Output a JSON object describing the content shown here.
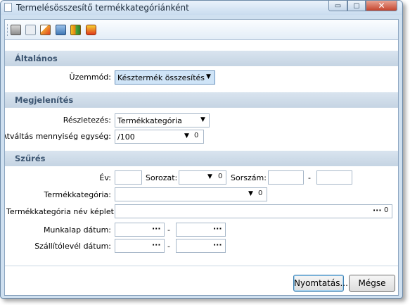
{
  "window": {
    "title": "Termelésösszesítő termékkategóriánként",
    "minimize_glyph": "▭",
    "maximize_glyph": "▢",
    "close_glyph": "✕"
  },
  "toolbar": {
    "icons": [
      "print-icon",
      "print-preview-icon",
      "edit-report-icon",
      "calculator-icon",
      "export-icon",
      "settings-icon"
    ]
  },
  "sections": {
    "general": "Általános",
    "display": "Megjelenítés",
    "filter": "Szűrés"
  },
  "general": {
    "mode_label": "Üzemmód:",
    "mode_value": "Késztermék összesítés"
  },
  "display": {
    "detail_label": "Részletezés:",
    "detail_value": "Termékkategória",
    "conversion_label": "Átváltás mennyiség egység:",
    "conversion_value": "/100"
  },
  "filter": {
    "year_label": "Év:",
    "year_value": "",
    "series_label": "Sorozat:",
    "series_value": "",
    "serial_label": "Sorszám:",
    "serial_from": "",
    "serial_to": "",
    "dash": "-",
    "category_label": "Termékkategória:",
    "category_value": "",
    "formula_label": "Termékkategória név képlet:",
    "formula_value": "",
    "worksheet_date_label": "Munkalap dátum:",
    "worksheet_from": "",
    "worksheet_to": "",
    "delivery_date_label": "Szállítólevél dátum:",
    "delivery_from": "",
    "delivery_to": ""
  },
  "glyphs": {
    "dropdown": "▼",
    "clip": "0",
    "ellipsis": "···"
  },
  "buttons": {
    "print": "Nyomtatás...",
    "cancel": "Mégse"
  }
}
